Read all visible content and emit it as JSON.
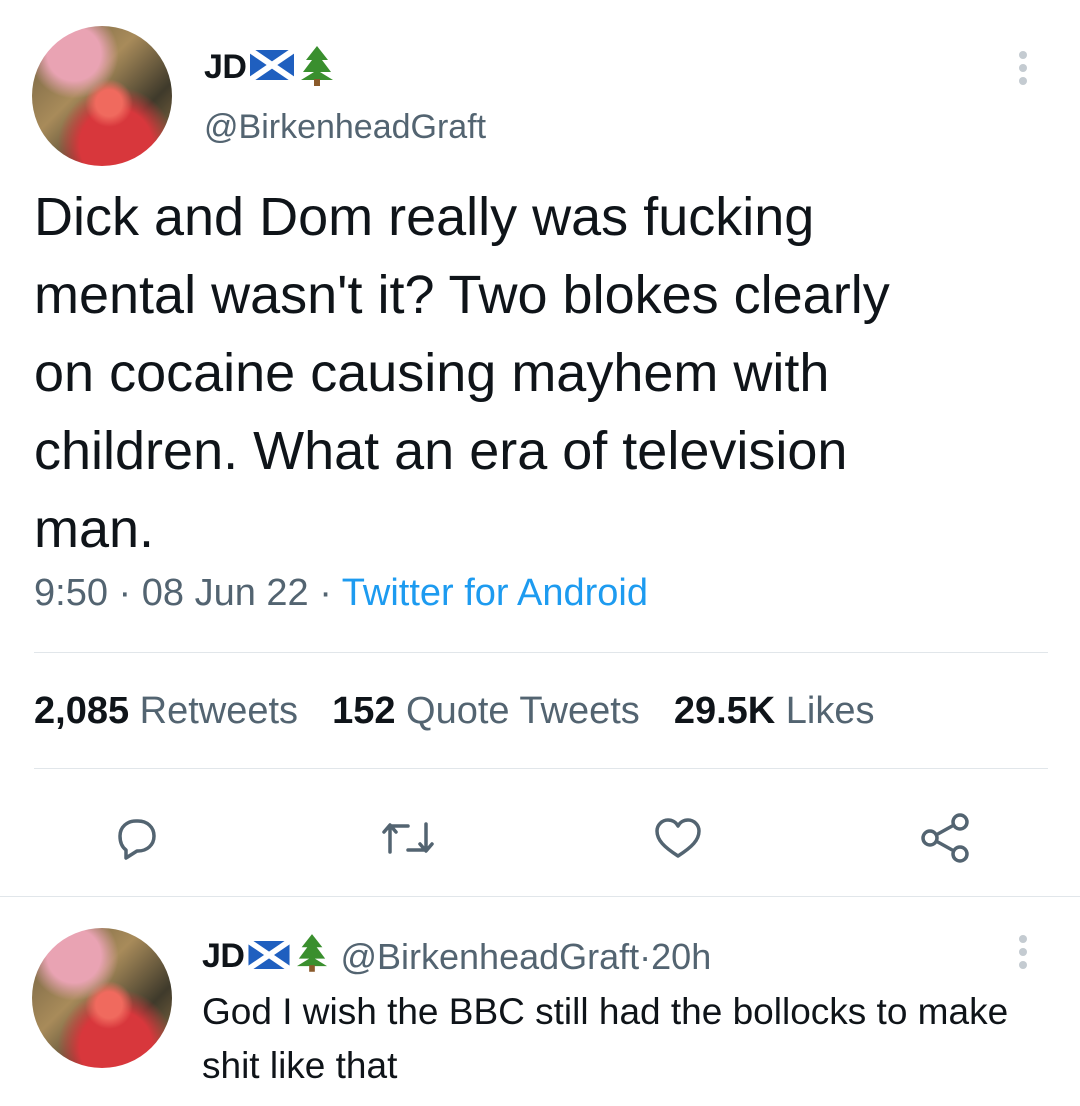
{
  "tweet": {
    "display_name": "JD",
    "handle": "@BirkenheadGraft",
    "text": "Dick and Dom really was fucking\nmental wasn't it? Two blokes clearly\non cocaine causing mayhem with\nchildren. What an era of television\nman.",
    "time": "9:50",
    "separator": " · ",
    "date": "08 Jun 22",
    "source": "Twitter for Android",
    "stats": {
      "retweets_count": "2,085",
      "retweets_label": "Retweets",
      "quotes_count": "152",
      "quotes_label": "Quote Tweets",
      "likes_count": "29.5K",
      "likes_label": "Likes"
    },
    "icons": {
      "avatar": "profile-photo",
      "flag": "scotland-flag-icon",
      "tree": "christmas-tree-icon",
      "more": "more-options-icon",
      "reply": "reply-icon",
      "retweet": "retweet-icon",
      "like": "heart-icon",
      "share": "share-icon"
    }
  },
  "reply": {
    "display_name": "JD",
    "handle": "@BirkenheadGraft",
    "separator": " · ",
    "age": "20h",
    "text": "God I wish the BBC still had the bollocks to make shit like that"
  },
  "colors": {
    "accent": "#1d9bf0",
    "secondary_text": "#536471",
    "divider": "#e1e6ea"
  }
}
